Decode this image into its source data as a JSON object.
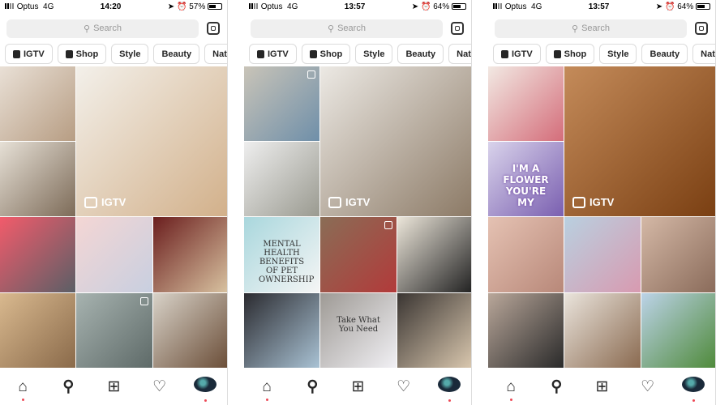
{
  "phones": [
    {
      "carrier": "Optus",
      "network": "4G",
      "time": "14:20",
      "battery": "57%",
      "battery_level": 57,
      "search_placeholder": "Search",
      "chips": [
        "IGTV",
        "Shop",
        "Style",
        "Beauty",
        "Nature"
      ],
      "igtv_label": "IGTV",
      "tiles": [
        {
          "colors": [
            "#e9e0d6",
            "#b79d83"
          ]
        },
        {
          "colors": [
            "#f3f0ea",
            "#d2b08a"
          ],
          "big": true,
          "igtv": true
        },
        {
          "colors": [
            "#e6e0d6",
            "#7d6b58"
          ]
        },
        {
          "colors": [
            "#f25b6b",
            "#5b5f66"
          ]
        },
        {
          "colors": [
            "#f4d6d4",
            "#c8cfe0"
          ]
        },
        {
          "colors": [
            "#6b1e1e",
            "#d8c2a0"
          ]
        },
        {
          "colors": [
            "#d9b98f",
            "#8a6a4a"
          ]
        },
        {
          "colors": [
            "#a7b3b0",
            "#5e6a68"
          ],
          "multi": true
        },
        {
          "colors": [
            "#d8d2c8",
            "#6b4e38"
          ]
        }
      ]
    },
    {
      "carrier": "Optus",
      "network": "4G",
      "time": "13:57",
      "battery": "64%",
      "battery_level": 64,
      "search_placeholder": "Search",
      "chips": [
        "IGTV",
        "Shop",
        "Style",
        "Beauty",
        "Nature"
      ],
      "igtv_label": "IGTV",
      "tiles": [
        {
          "colors": [
            "#c9c4b8",
            "#6f8fa9"
          ],
          "multi": true
        },
        {
          "colors": [
            "#ece9e4",
            "#8c7a66"
          ],
          "big": true,
          "igtv": true
        },
        {
          "colors": [
            "#eeeeee",
            "#9a9a90"
          ]
        },
        {
          "colors": [
            "#a9d7dd",
            "#f5f5f5"
          ],
          "text": "MENTAL HEALTH BENEFITS OF PET OWNERSHIP"
        },
        {
          "colors": [
            "#8a6d56",
            "#b23a3a"
          ],
          "multi": true
        },
        {
          "colors": [
            "#ece6da",
            "#222"
          ]
        },
        {
          "colors": [
            "#2b2b30",
            "#a9c2d4"
          ]
        },
        {
          "colors": [
            "#9e9a95",
            "#f1f0f4"
          ],
          "text": "Take What You Need"
        },
        {
          "colors": [
            "#3a3532",
            "#d9c7ae"
          ]
        }
      ]
    },
    {
      "carrier": "Optus",
      "network": "4G",
      "time": "13:57",
      "battery": "64%",
      "battery_level": 64,
      "search_placeholder": "Search",
      "chips": [
        "IGTV",
        "Shop",
        "Style",
        "Beauty",
        "Nature"
      ],
      "igtv_label": "IGTV",
      "tiles": [
        {
          "colors": [
            "#f2e9e3",
            "#d46d7a"
          ]
        },
        {
          "colors": [
            "#c48b5a",
            "#7a3f12"
          ],
          "big": true,
          "igtv": true
        },
        {
          "colors": [
            "#d9d3eb",
            "#7a5fb0"
          ],
          "text": "I'M A FLOWER YOU'RE MY",
          "flower": true
        },
        {
          "colors": [
            "#e5c2b3",
            "#b88879"
          ]
        },
        {
          "colors": [
            "#b9d0e0",
            "#d89ab0"
          ]
        },
        {
          "colors": [
            "#d4b8a6",
            "#8a6b5a"
          ]
        },
        {
          "colors": [
            "#b9a79a",
            "#2a2a2a"
          ]
        },
        {
          "colors": [
            "#eae4dc",
            "#8a6a50"
          ]
        },
        {
          "colors": [
            "#bcd3e8",
            "#4f8a3a"
          ]
        }
      ]
    }
  ]
}
